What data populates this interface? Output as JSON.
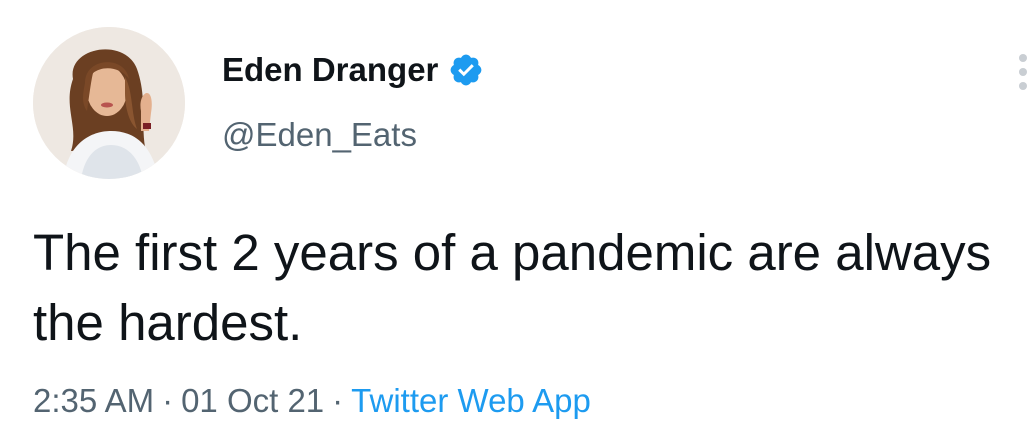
{
  "tweet": {
    "author": {
      "display_name": "Eden Dranger",
      "handle": "@Eden_Eats",
      "verified": true,
      "avatar_icon": "profile-photo"
    },
    "text": "The first 2 years of a pandemic are always the hardest.",
    "meta": {
      "time": "2:35 AM",
      "separator": "·",
      "date": "01 Oct 21",
      "source": "Twitter Web App"
    },
    "more_icon": "more-options-icon"
  },
  "colors": {
    "text_primary": "#0f1419",
    "text_secondary": "#536471",
    "link": "#1d9bf0",
    "verified_badge": "#1d9bf0",
    "background": "#ffffff"
  }
}
